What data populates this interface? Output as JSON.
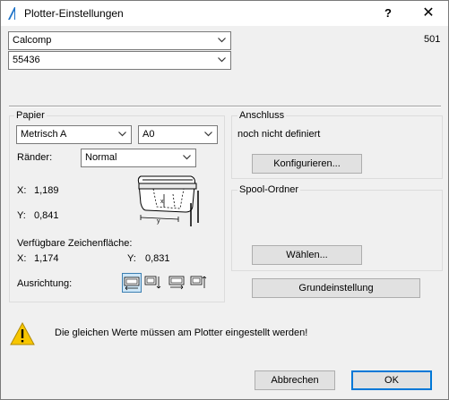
{
  "window": {
    "title": "Plotter-Einstellungen",
    "help_label": "?",
    "close_label": "✕"
  },
  "top": {
    "plotter_select": "Calcomp",
    "model_select": "55436",
    "number": "501"
  },
  "paper": {
    "group_title": "Papier",
    "format_select": "Metrisch A",
    "size_select": "A0",
    "margins_label": "Ränder:",
    "margins_select": "Normal",
    "x_label": "X:",
    "x_value": "1,189",
    "y_label": "Y:",
    "y_value": "0,841",
    "diagram_x": "x",
    "diagram_y": "y",
    "available_label": "Verfügbare Zeichenfläche:",
    "avail_x_label": "X:",
    "avail_x_value": "1,174",
    "avail_y_label": "Y:",
    "avail_y_value": "0,831",
    "orientation_label": "Ausrichtung:"
  },
  "connection": {
    "group_title": "Anschluss",
    "status": "noch nicht definiert",
    "configure_button": "Konfigurieren..."
  },
  "spool": {
    "group_title": "Spool-Ordner",
    "choose_button": "Wählen..."
  },
  "defaults_button": "Grundeinstellung",
  "warning_text": "Die gleichen Werte müssen am Plotter eingestellt werden!",
  "cancel_button": "Abbrechen",
  "ok_button": "OK",
  "colors": {
    "accent": "#0078d7",
    "warning": "#f7c600"
  }
}
